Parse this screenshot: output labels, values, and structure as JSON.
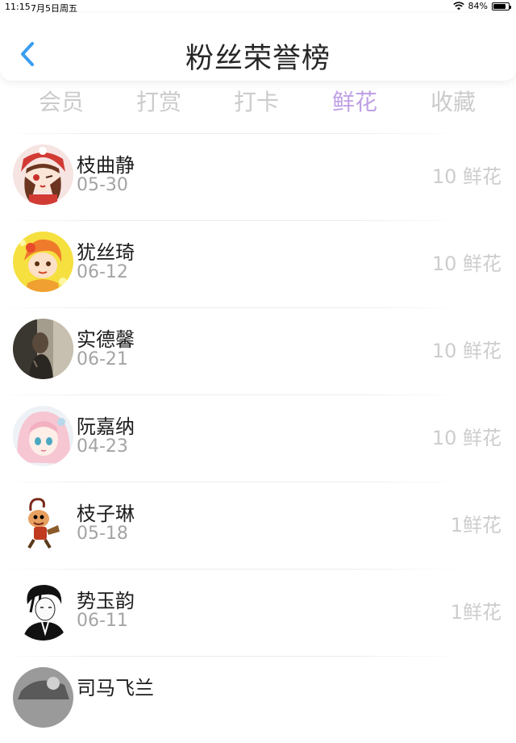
{
  "status_bar": {
    "time": "11:15",
    "date": "7月5日周五",
    "battery": "84%",
    "battery_level": 0.84
  },
  "header": {
    "title": "粉丝荣誉榜"
  },
  "tabs": [
    {
      "label": "会员",
      "active": false
    },
    {
      "label": "打赏",
      "active": false
    },
    {
      "label": "打卡",
      "active": false
    },
    {
      "label": "鲜花",
      "active": true
    },
    {
      "label": "收藏",
      "active": false
    }
  ],
  "fans": [
    {
      "name": "枝曲静",
      "date": "05-30",
      "count": "10 鲜花"
    },
    {
      "name": "犹丝琦",
      "date": "06-12",
      "count": "10 鲜花"
    },
    {
      "name": "实德馨",
      "date": "06-21",
      "count": "10 鲜花"
    },
    {
      "name": "阮嘉纳",
      "date": "04-23",
      "count": "10 鲜花"
    },
    {
      "name": "枝子琳",
      "date": "05-18",
      "count": "1鲜花"
    },
    {
      "name": "势玉韵",
      "date": "06-11",
      "count": "1鲜花"
    },
    {
      "name": "司马飞兰",
      "date": "",
      "count": ""
    }
  ],
  "colors": {
    "accent": "#c0a0e4",
    "back_arrow": "#3a9ef0"
  }
}
